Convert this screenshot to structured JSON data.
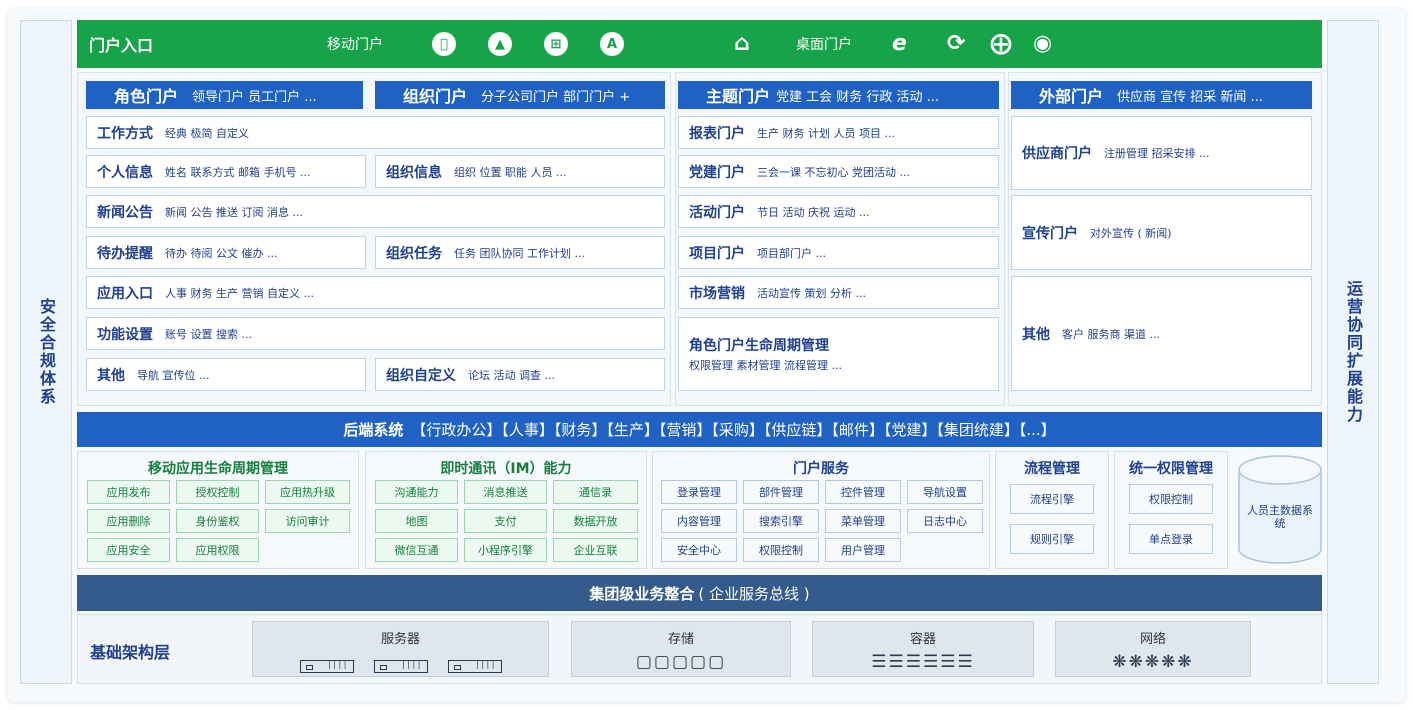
{
  "left_side": {
    "label": "安全合规体系"
  },
  "right_side": {
    "label": "运营协同扩展能力"
  },
  "entry": {
    "title": "门户入口",
    "mobile_label": "移动门户",
    "desktop_label": "桌面门户",
    "mobile_icons": [
      "apple-icon",
      "android-icon",
      "windows-icon",
      "app-store-icon"
    ],
    "desktop_icons": [
      "ie-icon",
      "edge-icon",
      "safari-icon",
      "chrome-icon"
    ]
  },
  "role_portal": {
    "head": "角色门户",
    "head_sub": "领导门户  员工门户 ...",
    "rows": [
      {
        "h": "工作方式",
        "s": "经典 极简 自定义"
      },
      {
        "h": "个人信息",
        "s": "姓名 联系方式 邮箱 手机号 ..."
      },
      {
        "h": "新闻公告",
        "s": "新闻 公告 推送 订阅 消息 ..."
      },
      {
        "h": "待办提醒",
        "s": "待办 待阅 公文 催办 ..."
      },
      {
        "h": "应用入口",
        "s": "人事 财务 生产 营销 自定义 ..."
      },
      {
        "h": "功能设置",
        "s": "账号 设置 搜索 ..."
      },
      {
        "h": "其他",
        "s": "导航 宣传位 ..."
      }
    ]
  },
  "org_portal": {
    "head": "组织门户",
    "head_sub": "分子公司门户  部门门户  +",
    "rows": [
      {
        "h": "组织信息",
        "s": "组织 位置 职能 人员 ..."
      },
      {
        "h": "组织任务",
        "s": "任务 团队协同 工作计划 ..."
      },
      {
        "h": "组织自定义",
        "s": "论坛 活动 调查 ..."
      }
    ]
  },
  "theme_portal": {
    "head": "主题门户",
    "head_sub": "党建 工会 财务 行政 活动 ...",
    "rows": [
      {
        "h": "报表门户",
        "s": "生产 财务 计划 人员 项目 ..."
      },
      {
        "h": "党建门户",
        "s": "三会一课 不忘初心 党团活动 ..."
      },
      {
        "h": "活动门户",
        "s": "节日 活动 庆祝 运动 ..."
      },
      {
        "h": "项目门户",
        "s": "项目部门户 ..."
      },
      {
        "h": "市场营销",
        "s": "活动宣传 策划 分析 ..."
      }
    ],
    "lifecycle": {
      "h": "角色门户生命周期管理",
      "s": "权限管理 素材管理 流程管理 ..."
    }
  },
  "external_portal": {
    "head": "外部门户",
    "head_sub": "供应商 宣传 招采 新闻 ...",
    "rows": [
      {
        "h": "供应商门户",
        "s": "注册管理 招采安排 ..."
      },
      {
        "h": "宣传门户",
        "s": "对外宣传 ( 新闻)"
      },
      {
        "h": "其他",
        "s": "客户 服务商 渠道 ..."
      }
    ]
  },
  "backend": {
    "head": "后端系统",
    "items": "【行政办公】【人事】【财务】【生产】【营销】【采购】【供应链】【邮件】【党建】【集团统建】【...】"
  },
  "mobile_lifecycle": {
    "title": "移动应用生命周期管理",
    "cells": [
      "应用发布",
      "授权控制",
      "应用热升级",
      "应用删除",
      "身份鉴权",
      "访问审计",
      "应用安全",
      "应用权限"
    ]
  },
  "im": {
    "title": "即时通讯（IM）能力",
    "cells": [
      "沟通能力",
      "消息推送",
      "通信录",
      "地图",
      "支付",
      "数据开放",
      "微信互通",
      "小程序引擎",
      "企业互联"
    ]
  },
  "portal_service": {
    "title": "门户服务",
    "cells": [
      "登录管理",
      "部件管理",
      "控件管理",
      "导航设置",
      "内容管理",
      "搜索引擎",
      "菜单管理",
      "日志中心",
      "安全中心",
      "权限控制",
      "用户管理"
    ]
  },
  "process": {
    "title": "流程管理",
    "cells": [
      "流程引擎",
      "规则引擎"
    ]
  },
  "permission": {
    "title": "统一权限管理",
    "cells": [
      "权限控制",
      "单点登录"
    ]
  },
  "master_data": {
    "label": "人员主数据系统"
  },
  "integration": {
    "head": "集团级业务整合",
    "sub": "( 企业服务总线 )"
  },
  "infra": {
    "title": "基础架构层",
    "boxes": [
      {
        "name": "服务器",
        "icon": "server-icon"
      },
      {
        "name": "存储",
        "icon": "cube-icon"
      },
      {
        "name": "容器",
        "icon": "container-icon"
      },
      {
        "name": "网络",
        "icon": "network-icon"
      }
    ]
  },
  "colors": {
    "green": "#16a34a",
    "blue": "#1f62c4",
    "navy": "#355b8c",
    "text": "#1f3f8f"
  }
}
